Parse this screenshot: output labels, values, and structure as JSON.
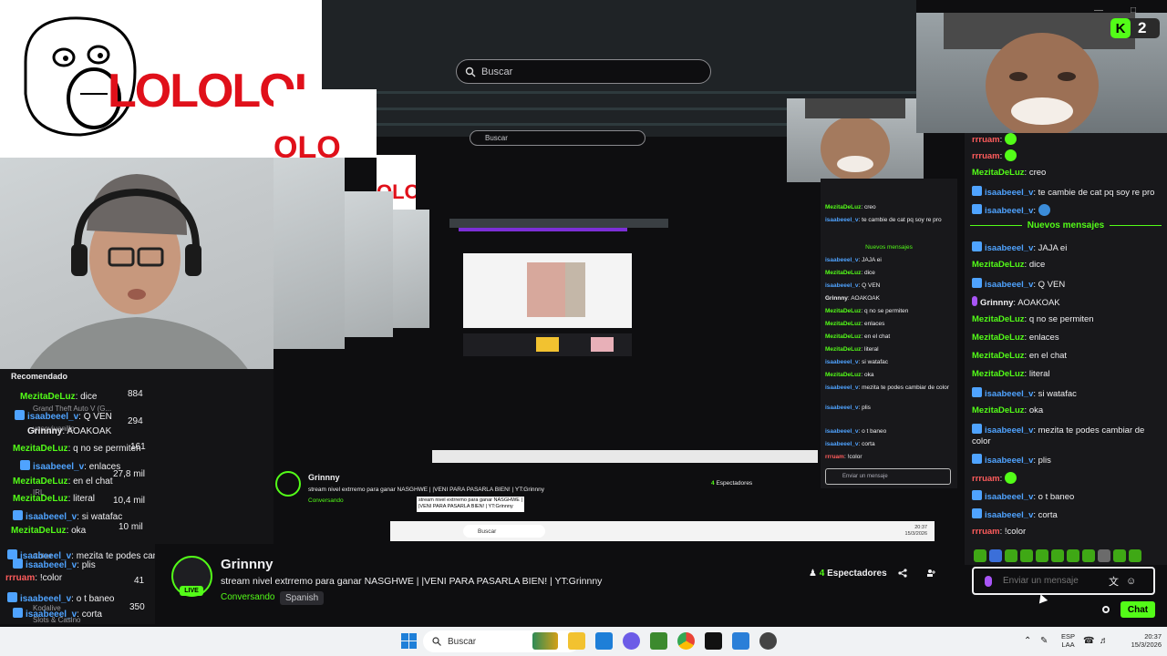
{
  "search": {
    "placeholder": "Buscar"
  },
  "meme": {
    "text": "LOLOLOLO",
    "echo1": "LOLOLOLO",
    "echo2": "OLO"
  },
  "react_cam": {
    "badge_letter": "K",
    "badge_count": "2"
  },
  "chat": {
    "messages": [
      {
        "user": "rrruam",
        "text": "",
        "color": "red"
      },
      {
        "user": "rrruam",
        "text": "",
        "color": "red"
      },
      {
        "user": "MezitaDeLuz",
        "text": "creo",
        "color": "green"
      },
      {
        "user": "isaabeeel_v",
        "text": "te cambie de cat pq soy re pro",
        "color": "blue"
      },
      {
        "user": "isaabeeel_v",
        "text": "",
        "color": "blue"
      },
      {
        "user": "isaabeeel_v",
        "text": "JAJA ei",
        "color": "blue"
      },
      {
        "user": "MezitaDeLuz",
        "text": "dice",
        "color": "green"
      },
      {
        "user": "isaabeeel_v",
        "text": "Q VEN",
        "color": "blue"
      },
      {
        "user": "Grinnny",
        "text": "AOAKOAK",
        "color": "white"
      },
      {
        "user": "MezitaDeLuz",
        "text": "q no se permiten",
        "color": "green"
      },
      {
        "user": "MezitaDeLuz",
        "text": "enlaces",
        "color": "green"
      },
      {
        "user": "MezitaDeLuz",
        "text": "en el chat",
        "color": "green"
      },
      {
        "user": "MezitaDeLuz",
        "text": "literal",
        "color": "green"
      },
      {
        "user": "isaabeeel_v",
        "text": "si watafac",
        "color": "blue"
      },
      {
        "user": "MezitaDeLuz",
        "text": "oka",
        "color": "green"
      },
      {
        "user": "isaabeeel_v",
        "text": "mezita te podes cambiar de color",
        "color": "blue"
      },
      {
        "user": "isaabeeel_v",
        "text": "plis",
        "color": "blue"
      },
      {
        "user": "rrruam",
        "text": "",
        "color": "red"
      },
      {
        "user": "isaabeeel_v",
        "text": "o t baneo",
        "color": "blue"
      },
      {
        "user": "isaabeeel_v",
        "text": "corta",
        "color": "blue"
      },
      {
        "user": "rrruam",
        "text": "!color",
        "color": "red"
      }
    ],
    "new_messages_label": "Nuevos mensajes",
    "input_placeholder": "Enviar un mensaje",
    "send_label": "Chat"
  },
  "left_panel": {
    "header": "Recomendado",
    "ghost_lines": [
      {
        "user": "MezitaDeLuz",
        "text": "dice"
      },
      {
        "user": "isaabeeel_v",
        "text": "Q VEN"
      },
      {
        "user": "Grinnny",
        "text": "AOAKOAK"
      },
      {
        "user": "MezitaDeLuz",
        "text": "q no se permiten"
      },
      {
        "user": "isaabeeel_v",
        "text": "enlaces"
      },
      {
        "user": "MezitaDeLuz",
        "text": "en el chat"
      },
      {
        "user": "MezitaDeLuz",
        "text": "literal"
      },
      {
        "user": "isaabeeel_v",
        "text": "si watafac"
      },
      {
        "user": "MezitaDeLuz",
        "text": "oka"
      },
      {
        "user": "isaabeeel_v",
        "text": "mezita te podes cambiar de color"
      },
      {
        "user": "isaabeeel_v",
        "text": "plis"
      },
      {
        "user": "isaabeeel_v",
        "text": "o t baneo"
      },
      {
        "user": "isaabeeel_v",
        "text": "corta"
      },
      {
        "user": "rrruam",
        "text": "!color"
      }
    ],
    "channels": [
      "Grand Theft Auto V (G...",
      "yosoyjuanillo",
      "IRL",
      "Coker",
      "Kodalive",
      "Slots & Casino"
    ],
    "counts": [
      "884",
      "294",
      "161",
      "27,8 mil",
      "10,4 mil",
      "10 mil",
      "41",
      "350"
    ]
  },
  "stream": {
    "name": "Grinnny",
    "title": "stream nivel extrremo para ganar NASGHWE |  |VENI PARA PASARLA BIEN! | YT:Grinnny",
    "category": "Conversando",
    "language": "Spanish",
    "viewers_count": "4",
    "viewers_label": "Espectadores",
    "live_label": "LIVE"
  },
  "tooltip": "stream nivel extrremo para ganar NASGHWE |  |VENI PARA PASARLA BIEN! | YT:Grinnny",
  "taskbar": {
    "search_placeholder": "Buscar",
    "lang_1": "ESP",
    "lang_2": "LAA",
    "time": "20:37",
    "date": "15/3/2026"
  },
  "colors": {
    "accent": "#53fc18",
    "bg": "#0e0e10",
    "panel": "#18181b"
  }
}
